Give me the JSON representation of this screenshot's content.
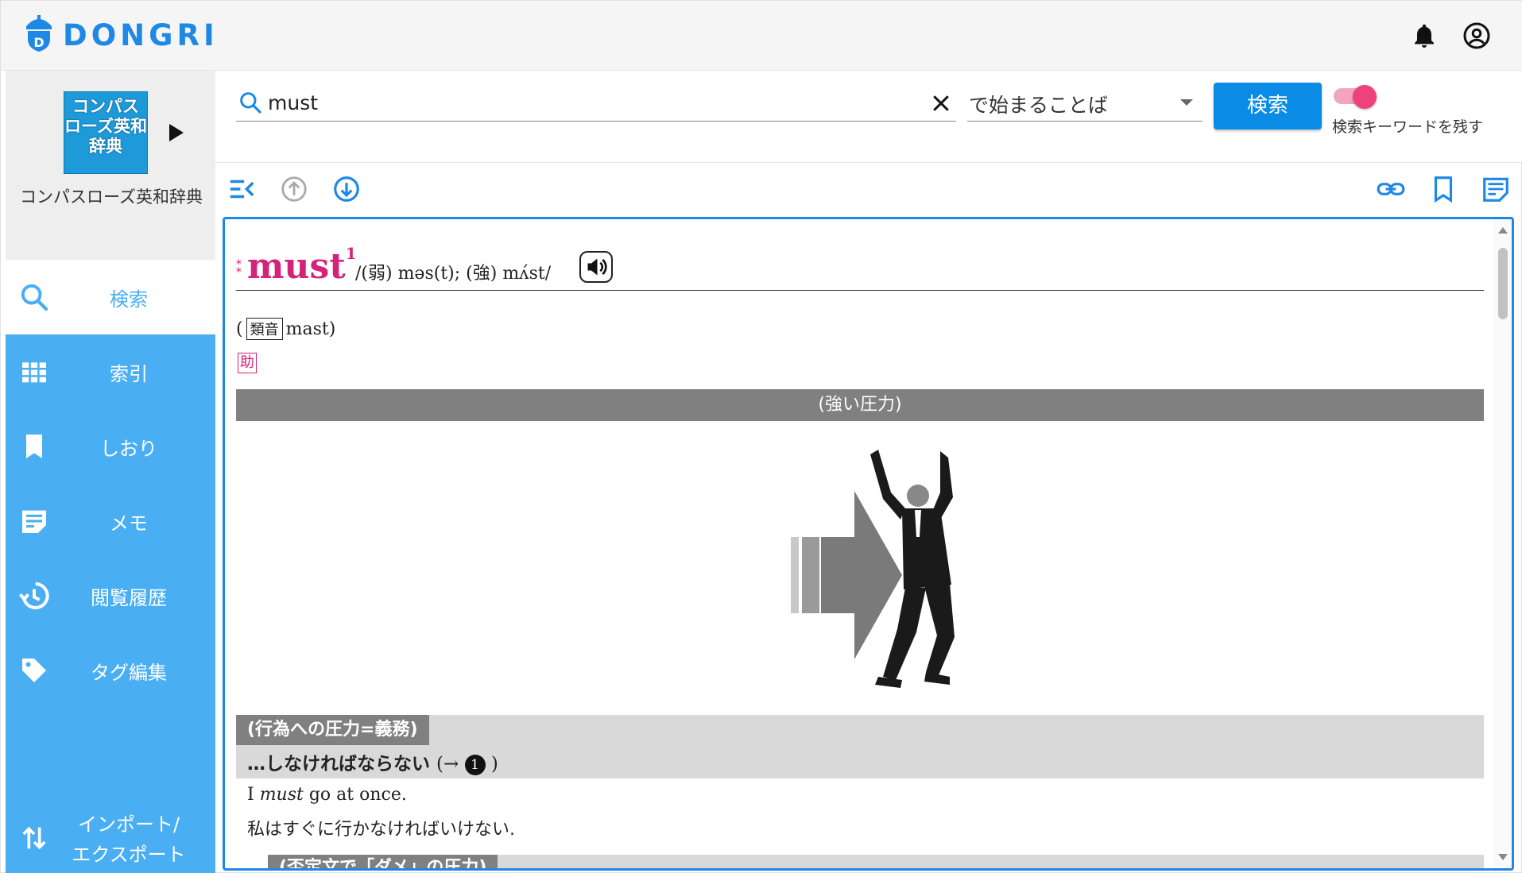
{
  "app": {
    "name": "DONGRI"
  },
  "header": {
    "notifications_icon": "bell-icon",
    "account_icon": "account-circle-icon"
  },
  "sidebar": {
    "book_cover_text": "コンパスローズ英和辞典",
    "book_name": "コンパスローズ英和辞典",
    "items": [
      {
        "label": "検索",
        "icon": "search-icon",
        "active": true
      },
      {
        "label": "索引",
        "icon": "grid-icon"
      },
      {
        "label": "しおり",
        "icon": "bookmark-icon"
      },
      {
        "label": "メモ",
        "icon": "memo-icon"
      },
      {
        "label": "閲覧履歴",
        "icon": "history-icon"
      },
      {
        "label": "タグ編集",
        "icon": "tag-icon"
      }
    ],
    "import_export_line1": "インポート/",
    "import_export_line2": "エクスポート"
  },
  "search": {
    "value": "must",
    "mode": "で始まることば",
    "button_label": "検索",
    "keep_keyword_label": "検索キーワードを残す",
    "keep_keyword_on": true
  },
  "colors": {
    "accent": "#1e88e5",
    "sidebar": "#4aaef2",
    "headword": "#d4237a",
    "toggle": "#f0427a"
  },
  "entry": {
    "stars": "**",
    "headword": "must",
    "homograph": "1",
    "pronunciation": "/(弱) məs(t); (強) mʌ́st/",
    "similar_open": "(",
    "similar_tag": "類音",
    "similar_word": "mast",
    "similar_close": ")",
    "pos": "助",
    "core_label": "(強い圧力)",
    "section_tag": "(行為への圧力=義務)",
    "section_title": "…しなければならない",
    "section_ref_open": "(→",
    "section_ref_num": "1",
    "section_ref_close": ")",
    "example_pre": "I ",
    "example_em": "must",
    "example_post": " go at once.",
    "example_ja": "私はすぐに行かなければいけない.",
    "next_section_tag": "(否定文で「ダメ」の圧力)"
  }
}
